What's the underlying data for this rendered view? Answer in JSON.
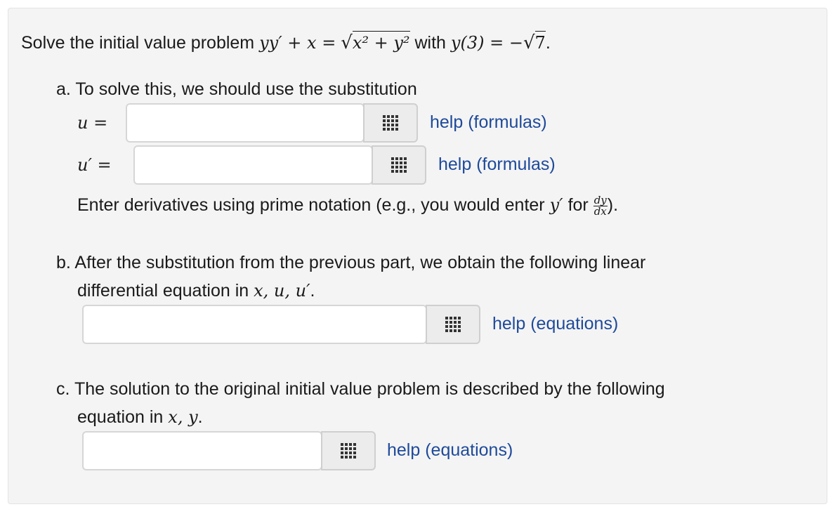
{
  "problem": {
    "prefix": "Solve the initial value problem",
    "lhs": "yy′ + x =",
    "radicand": "x² + y²",
    "with": "with",
    "ic_lhs": "y(3) = −",
    "ic_radicand": "7",
    "period": "."
  },
  "part_a": {
    "prompt": "a. To solve this, we should use the substitution",
    "u_label": "u =",
    "up_label": "u′ =",
    "u_value": "",
    "up_value": "",
    "help_u": "help (formulas)",
    "help_up": "help (formulas)",
    "note_prefix": "Enter derivatives using prime notation (e.g., you would enter",
    "note_var": "y′",
    "note_for": "for",
    "note_num": "dy",
    "note_den": "dx",
    "note_suffix": ")."
  },
  "part_b": {
    "line1": "b. After the substitution from the previous part, we obtain the following linear",
    "line2_prefix": "differential equation in",
    "line2_vars": "x, u, u′",
    "line2_suffix": ".",
    "value": "",
    "help": "help (equations)"
  },
  "part_c": {
    "line1": "c. The solution to the original initial value problem is described by the following",
    "line2_prefix": "equation in",
    "line2_vars": "x, y",
    "line2_suffix": ".",
    "value": "",
    "help": "help (equations)"
  },
  "icons": {
    "palette": "grid-icon"
  }
}
